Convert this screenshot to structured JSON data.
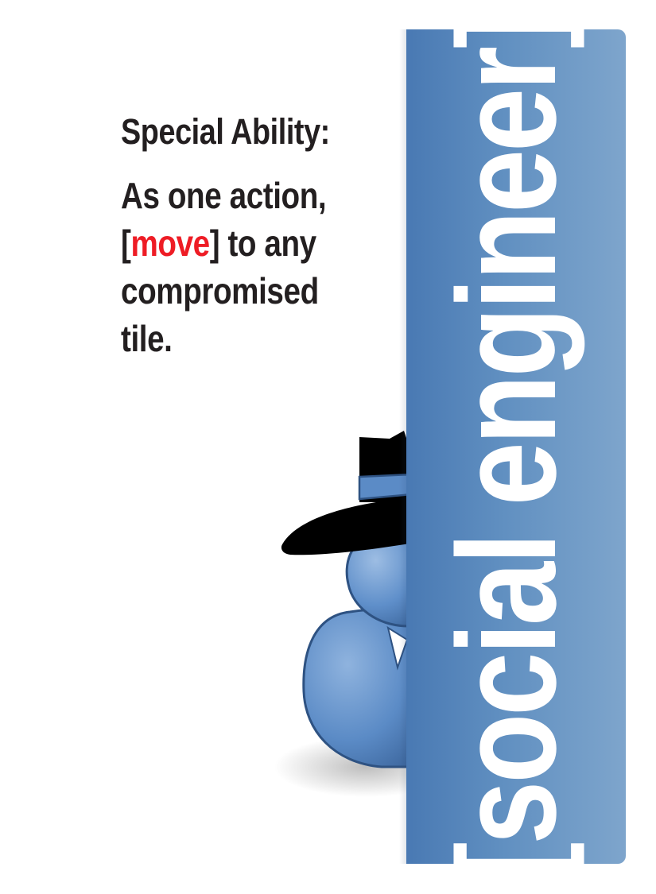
{
  "card": {
    "role": "[social engineer]",
    "ability_heading": "Special Ability:",
    "ability_text": {
      "line1": "As one action,",
      "line2_open": "[",
      "line2_keyword": "move",
      "line2_close": "] to any",
      "line3": "compromised",
      "line4": "tile."
    },
    "colors": {
      "banner": "#4979b3",
      "banner_light": "#7ea5cc",
      "keyword": "#ee1c25",
      "text": "#231f20",
      "hat": "#000000",
      "figure": "#5b8bc6"
    },
    "icons": {
      "figure": "spy-figure-icon"
    }
  }
}
